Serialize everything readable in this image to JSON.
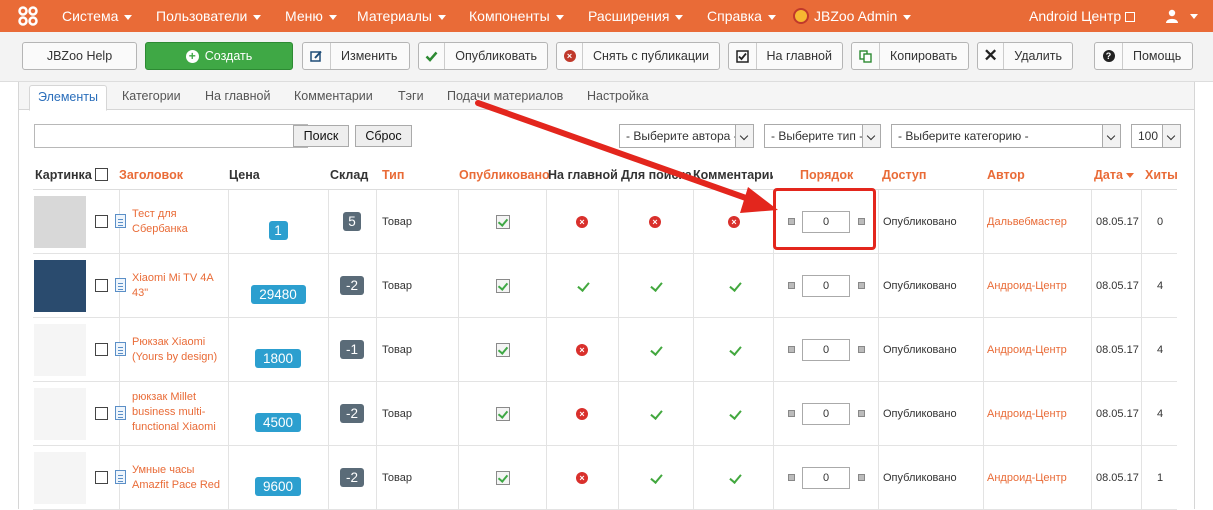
{
  "topnav": {
    "menu": [
      {
        "label": "Система"
      },
      {
        "label": "Пользователи"
      },
      {
        "label": "Меню"
      },
      {
        "label": "Материалы"
      },
      {
        "label": "Компоненты"
      },
      {
        "label": "Расширения"
      },
      {
        "label": "Справка"
      }
    ],
    "admin_label": "JBZoo Admin",
    "site_link": "Android Центр",
    "brand_color": "#e96b37"
  },
  "toolbar": {
    "help": "JBZoo Help",
    "create": "Создать",
    "edit": "Изменить",
    "publish": "Опубликовать",
    "unpublish": "Снять с публикации",
    "featured": "На главной",
    "copy": "Копировать",
    "delete": "Удалить",
    "help2": "Помощь"
  },
  "tabs": [
    {
      "label": "Элементы"
    },
    {
      "label": "Категории"
    },
    {
      "label": "На главной"
    },
    {
      "label": "Комментарии"
    },
    {
      "label": "Тэги"
    },
    {
      "label": "Подачи материалов"
    },
    {
      "label": "Настройка"
    }
  ],
  "filters": {
    "search_value": "",
    "search_btn": "Поиск",
    "reset_btn": "Сброс",
    "author": "- Выберите автора -",
    "type": "- Выберите тип -",
    "category": "- Выберите категорию -",
    "limit": "100"
  },
  "columns": {
    "image": "Картинка",
    "title": "Заголовок",
    "price": "Цена",
    "stock": "Склад",
    "type": "Тип",
    "published": "Опубликовано",
    "featured": "На главной",
    "search": "Для поиска",
    "comments": "Комментарии",
    "order": "Порядок",
    "access": "Доступ",
    "author": "Автор",
    "date": "Дата",
    "hits": "Хиты"
  },
  "rows": [
    {
      "title": "Тест для Сбербанка",
      "price": "1",
      "stock": "5",
      "type": "Товар",
      "featured": false,
      "search": false,
      "comments": false,
      "order": "0",
      "access": "Опубликовано",
      "author": "Дальвебмастер",
      "date": "08.05.17",
      "hits": "0"
    },
    {
      "title": "Xiaomi Mi TV 4A 43\"",
      "price": "29480",
      "stock": "-2",
      "type": "Товар",
      "featured": true,
      "search": true,
      "comments": true,
      "order": "0",
      "access": "Опубликовано",
      "author": "Андроид-Центр",
      "date": "08.05.17",
      "hits": "4"
    },
    {
      "title": "Рюкзак Xiaomi (Yours by design)",
      "price": "1800",
      "stock": "-1",
      "type": "Товар",
      "featured": false,
      "search": true,
      "comments": true,
      "order": "0",
      "access": "Опубликовано",
      "author": "Андроид-Центр",
      "date": "08.05.17",
      "hits": "4"
    },
    {
      "title": "рюкзак Millet business multi-functional Xiaomi",
      "price": "4500",
      "stock": "-2",
      "type": "Товар",
      "featured": false,
      "search": true,
      "comments": true,
      "order": "0",
      "access": "Опубликовано",
      "author": "Андроид-Центр",
      "date": "08.05.17",
      "hits": "4"
    },
    {
      "title": "Умные часы Amazfit Pace Red",
      "price": "9600",
      "stock": "-2",
      "type": "Товар",
      "featured": false,
      "search": true,
      "comments": true,
      "order": "0",
      "access": "Опубликовано",
      "author": "Андроид-Центр",
      "date": "08.05.17",
      "hits": "1"
    }
  ]
}
